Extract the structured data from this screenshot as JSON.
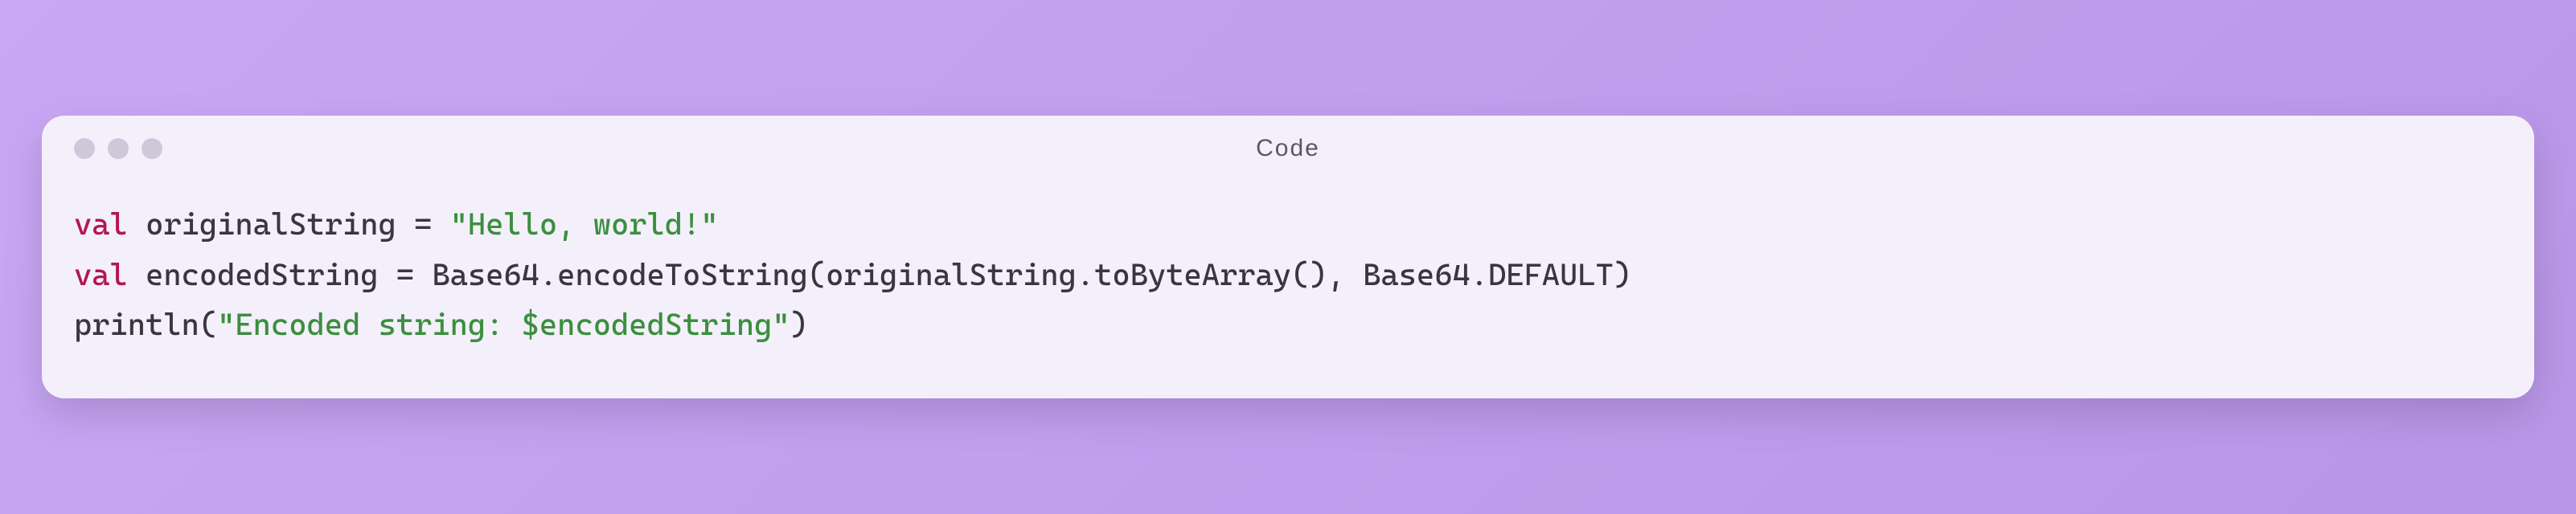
{
  "window": {
    "title": "Code"
  },
  "code": {
    "lines": [
      {
        "tokens": [
          {
            "cls": "tok-keyword",
            "text": "val"
          },
          {
            "cls": "tok-ident",
            "text": " originalString "
          },
          {
            "cls": "tok-punct",
            "text": "= "
          },
          {
            "cls": "tok-string",
            "text": "\"Hello, world!\""
          }
        ]
      },
      {
        "tokens": [
          {
            "cls": "tok-keyword",
            "text": "val"
          },
          {
            "cls": "tok-ident",
            "text": " encodedString "
          },
          {
            "cls": "tok-punct",
            "text": "= "
          },
          {
            "cls": "tok-ident",
            "text": "Base64"
          },
          {
            "cls": "tok-punct",
            "text": "."
          },
          {
            "cls": "tok-ident",
            "text": "encodeToString"
          },
          {
            "cls": "tok-punct",
            "text": "("
          },
          {
            "cls": "tok-ident",
            "text": "originalString"
          },
          {
            "cls": "tok-punct",
            "text": "."
          },
          {
            "cls": "tok-ident",
            "text": "toByteArray"
          },
          {
            "cls": "tok-punct",
            "text": "(), "
          },
          {
            "cls": "tok-ident",
            "text": "Base64"
          },
          {
            "cls": "tok-punct",
            "text": "."
          },
          {
            "cls": "tok-ident",
            "text": "DEFAULT"
          },
          {
            "cls": "tok-punct",
            "text": ")"
          }
        ]
      },
      {
        "tokens": [
          {
            "cls": "tok-ident",
            "text": "println"
          },
          {
            "cls": "tok-punct",
            "text": "("
          },
          {
            "cls": "tok-string",
            "text": "\"Encoded string: "
          },
          {
            "cls": "tok-interp",
            "text": "$encodedString"
          },
          {
            "cls": "tok-string",
            "text": "\""
          },
          {
            "cls": "tok-punct",
            "text": ")"
          }
        ]
      }
    ]
  }
}
